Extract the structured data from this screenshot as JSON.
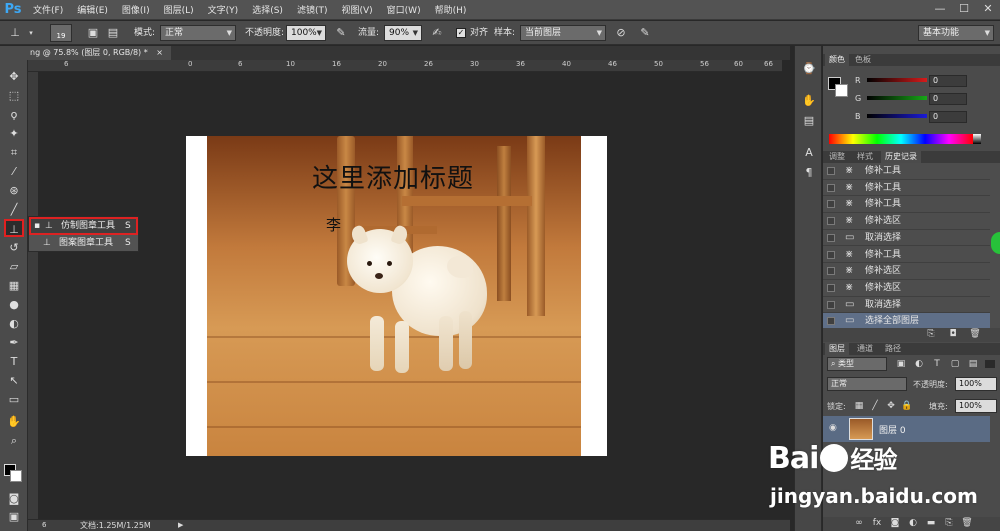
{
  "app": {
    "logo": "Ps",
    "menu": [
      "文件(F)",
      "编辑(E)",
      "图像(I)",
      "图层(L)",
      "文字(Y)",
      "选择(S)",
      "滤镜(T)",
      "视图(V)",
      "窗口(W)",
      "帮助(H)"
    ],
    "window_buttons": [
      "—",
      "☐",
      "✕"
    ]
  },
  "options_bar": {
    "brush_size": "19",
    "mode_label": "模式:",
    "mode_value": "正常",
    "opacity_label": "不透明度:",
    "opacity_value": "100%",
    "flow_label": "流量:",
    "flow_value": "90%",
    "align_label": "对齐",
    "sample_label": "样本:",
    "sample_value": "当前图层",
    "workspace_value": "基本功能"
  },
  "document": {
    "tab_title": "ng @ 75.8% (图层 0, RGB/8) *",
    "tab_close": "×",
    "ruler_ticks": [
      "6",
      "0",
      "6",
      "10",
      "16",
      "20",
      "26",
      "30",
      "36",
      "40",
      "46",
      "50",
      "56",
      "60",
      "66"
    ],
    "canvas_title": "这里添加标题",
    "canvas_subtitle": "李"
  },
  "flyout": {
    "items": [
      {
        "label": "仿制图章工具",
        "shortcut": "S",
        "selected": true
      },
      {
        "label": "图案图章工具",
        "shortcut": "S",
        "selected": false
      }
    ]
  },
  "status": {
    "zoom": "6",
    "doc_size": "文档:1.25M/1.25M",
    "arrow": "▶"
  },
  "color_panel": {
    "tabs": [
      "颜色",
      "色板"
    ],
    "channels": [
      {
        "label": "R",
        "value": "0",
        "color": "#d81b1b"
      },
      {
        "label": "G",
        "value": "0",
        "color": "#18a818"
      },
      {
        "label": "B",
        "value": "0",
        "color": "#1b1bd8"
      }
    ]
  },
  "history_panel": {
    "tabs": [
      "调整",
      "样式",
      "历史记录"
    ],
    "items": [
      "修补工具",
      "修补工具",
      "修补工具",
      "修补选区",
      "取消选择",
      "修补工具",
      "修补选区",
      "修补选区",
      "取消选择",
      "选择全部图层"
    ]
  },
  "layers_panel": {
    "tabs": [
      "图层",
      "通道",
      "路径"
    ],
    "kind_label": "类型",
    "blend_value": "正常",
    "opacity_label": "不透明度:",
    "opacity_value": "100%",
    "lock_label": "锁定:",
    "fill_label": "填充:",
    "fill_value": "100%",
    "layer_name": "图层 0"
  },
  "watermark": {
    "brand": "Bai",
    "brand_suffix": "经验",
    "url": "jingyan.baidu.com"
  }
}
